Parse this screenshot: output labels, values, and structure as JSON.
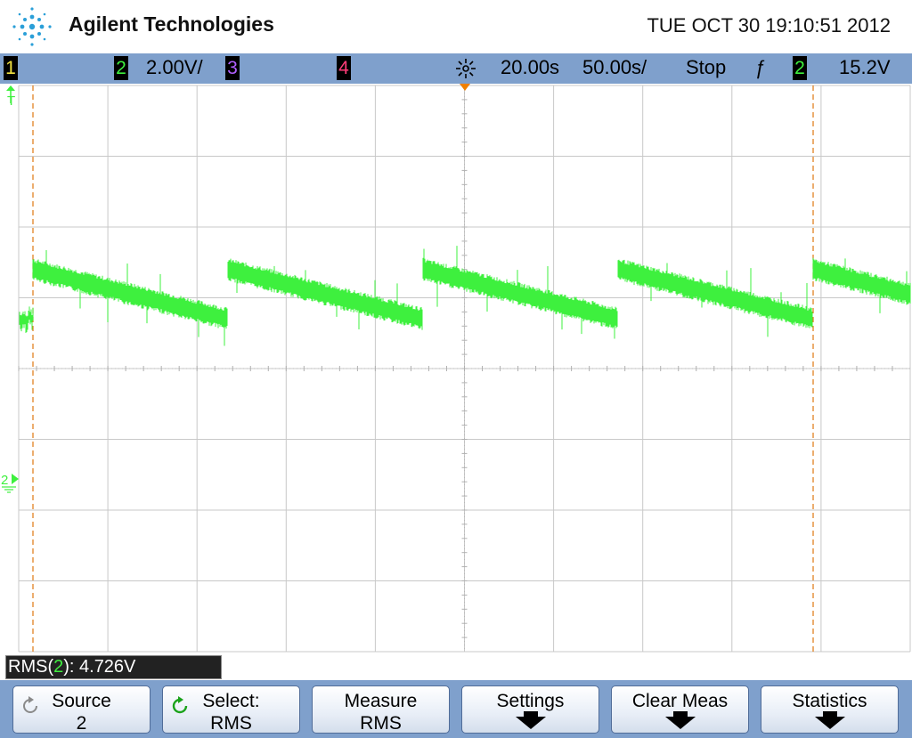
{
  "header": {
    "brand": "Agilent Technologies",
    "datetime": "TUE OCT 30 19:10:51 2012"
  },
  "status_bar": {
    "ch1_number": "1",
    "ch2_number": "2",
    "ch2_scale": "2.00V/",
    "ch3_number": "3",
    "ch4_number": "4",
    "time_delay": "20.00s",
    "time_scale": "50.00s/",
    "run_state": "Stop",
    "trigger_slope_symbol": "ƒ",
    "trigger_source": "2",
    "trigger_level": "15.2V",
    "colors": {
      "ch1": "#f0e040",
      "ch2": "#3ef03e",
      "ch3": "#b060ff",
      "ch4": "#ff3c78"
    }
  },
  "markers": {
    "trigger_ref": "T",
    "ch2_ground": "2"
  },
  "measurement": {
    "prefix": "RMS(",
    "channel": "2",
    "suffix": "): 4.726V"
  },
  "softkeys": [
    {
      "line1": "Source",
      "line2": "2",
      "icon": "rotate-icon"
    },
    {
      "line1": "Select:",
      "line2": "RMS",
      "icon": "rotate-green-icon"
    },
    {
      "line1": "Measure",
      "line2": "RMS",
      "icon": ""
    },
    {
      "line1": "Settings",
      "line2": "",
      "icon": "down-arrow-icon"
    },
    {
      "line1": "Clear Meas",
      "line2": "",
      "icon": "down-arrow-icon"
    },
    {
      "line1": "Statistics",
      "line2": "",
      "icon": "down-arrow-icon"
    }
  ],
  "trace": {
    "channel": "2",
    "color": "#3ef03e",
    "shape": "sawtooth",
    "cycles": 4,
    "high_div": 2.9,
    "low_div": 2.2,
    "noise_div": 0.08
  }
}
